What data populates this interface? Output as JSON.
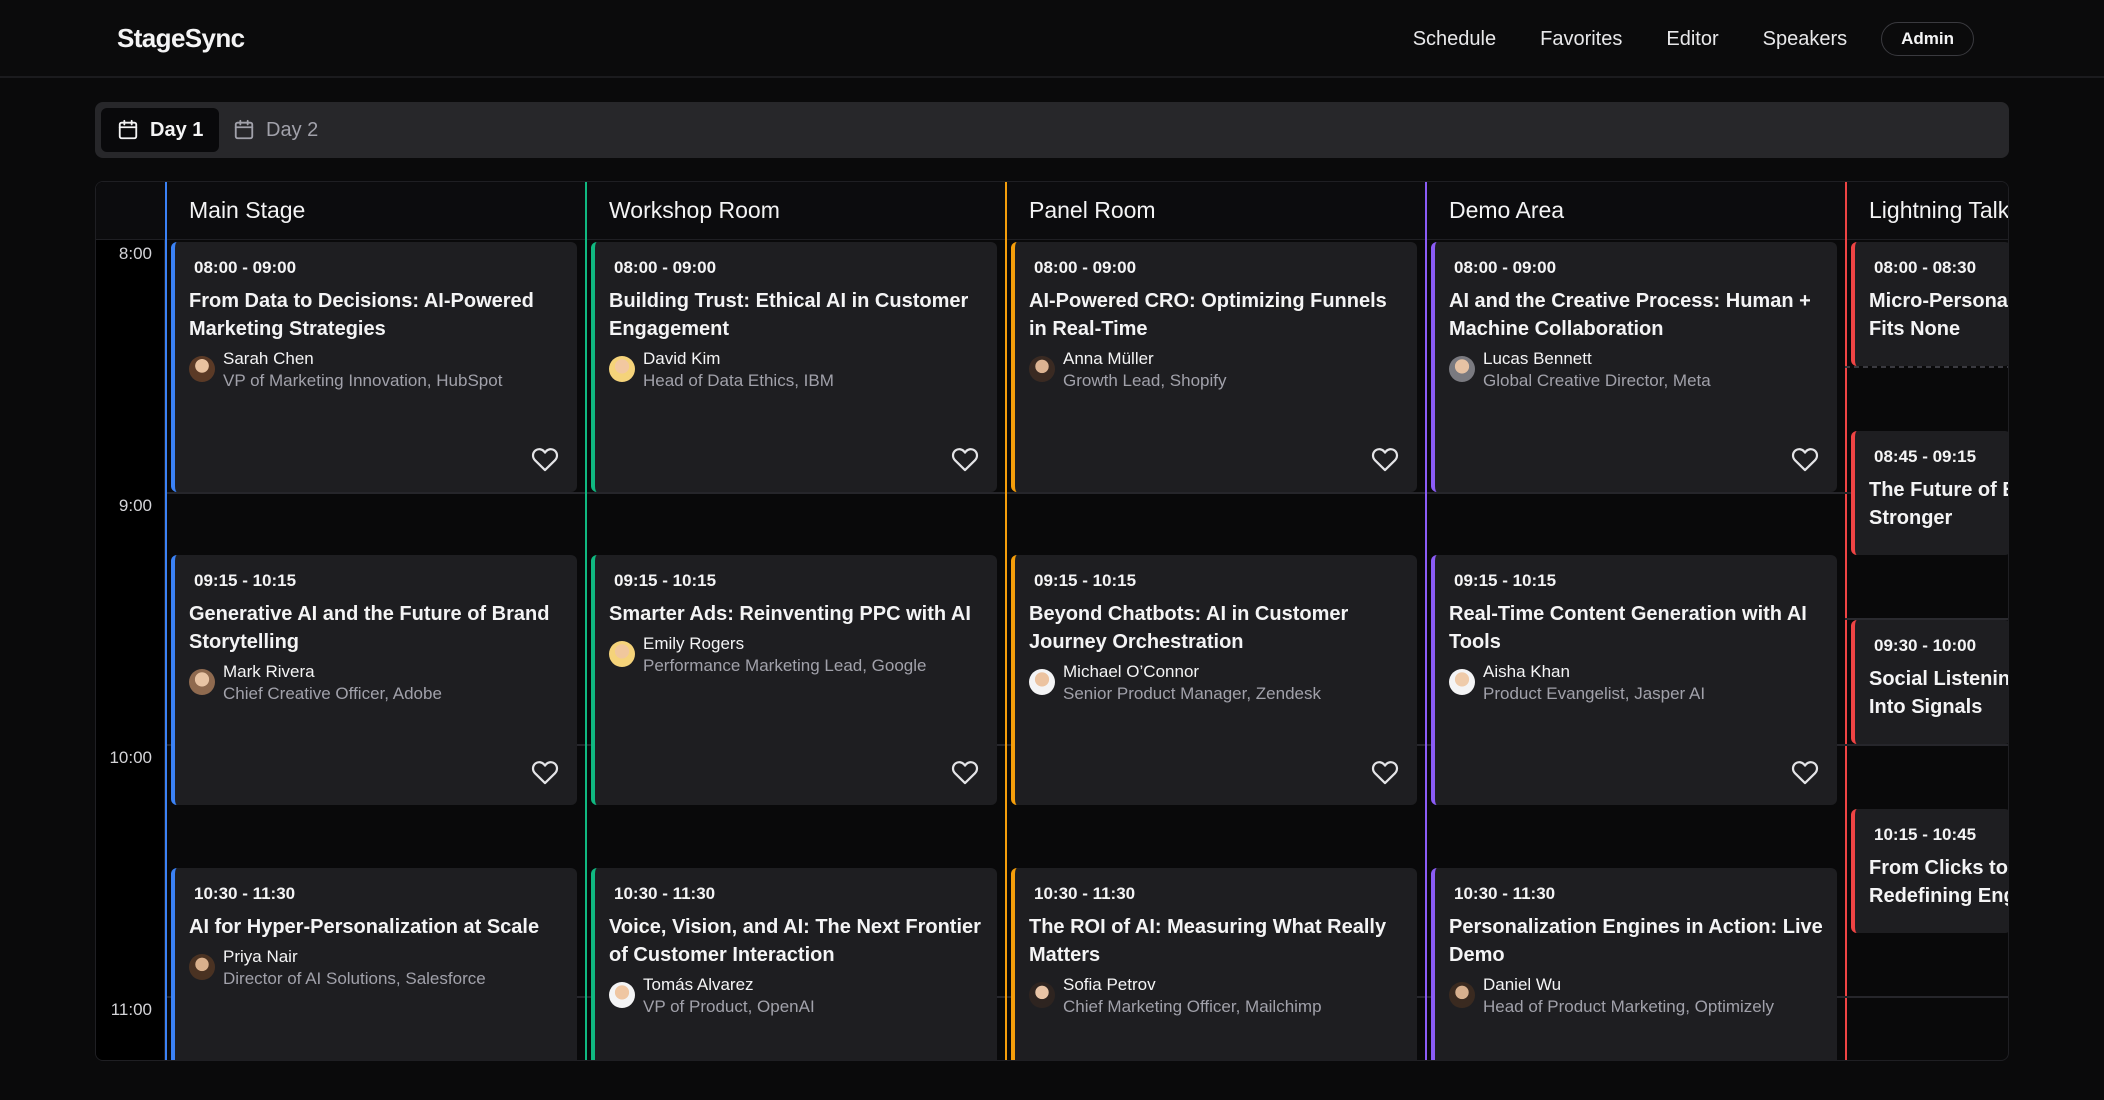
{
  "app": {
    "title": "StageSync"
  },
  "nav": {
    "schedule": "Schedule",
    "favorites": "Favorites",
    "editor": "Editor",
    "speakers": "Speakers",
    "admin": "Admin"
  },
  "days": [
    {
      "label": "Day 1"
    },
    {
      "label": "Day 2"
    }
  ],
  "times": [
    "8:00",
    "9:00",
    "10:00",
    "11:00"
  ],
  "rooms": [
    {
      "name": "Main Stage",
      "color": "#3b82f6",
      "sessions": [
        {
          "time": "08:00 - 09:00",
          "title": "From Data to Decisions: AI-Powered Marketing Strategies",
          "speaker": "Sarah Chen",
          "role": "VP of Marketing Innovation, HubSpot"
        },
        {
          "time": "09:15 - 10:15",
          "title": "Generative AI and the Future of Brand Storytelling",
          "speaker": "Mark Rivera",
          "role": "Chief Creative Officer, Adobe"
        },
        {
          "time": "10:30 - 11:30",
          "title": "AI for Hyper-Personalization at Scale",
          "speaker": "Priya Nair",
          "role": "Director of AI Solutions, Salesforce"
        }
      ]
    },
    {
      "name": "Workshop Room",
      "color": "#10b981",
      "sessions": [
        {
          "time": "08:00 - 09:00",
          "title": "Building Trust: Ethical AI in Customer Engagement",
          "speaker": "David Kim",
          "role": "Head of Data Ethics, IBM"
        },
        {
          "time": "09:15 - 10:15",
          "title": "Smarter Ads: Reinventing PPC with AI",
          "speaker": "Emily Rogers",
          "role": "Performance Marketing Lead, Google"
        },
        {
          "time": "10:30 - 11:30",
          "title": "Voice, Vision, and AI: The Next Frontier of Customer Interaction",
          "speaker": "Tomás Alvarez",
          "role": "VP of Product, OpenAI"
        }
      ]
    },
    {
      "name": "Panel Room",
      "color": "#f59e0b",
      "sessions": [
        {
          "time": "08:00 - 09:00",
          "title": "AI-Powered CRO: Optimizing Funnels in Real-Time",
          "speaker": "Anna Müller",
          "role": "Growth Lead, Shopify"
        },
        {
          "time": "09:15 - 10:15",
          "title": "Beyond Chatbots: AI in Customer Journey Orchestration",
          "speaker": "Michael O’Connor",
          "role": "Senior Product Manager, Zendesk"
        },
        {
          "time": "10:30 - 11:30",
          "title": "The ROI of AI: Measuring What Really Matters",
          "speaker": "Sofia Petrov",
          "role": "Chief Marketing Officer, Mailchimp"
        }
      ]
    },
    {
      "name": "Demo Area",
      "color": "#8b5cf6",
      "sessions": [
        {
          "time": "08:00 - 09:00",
          "title": "AI and the Creative Process: Human + Machine Collaboration",
          "speaker": "Lucas Bennett",
          "role": "Global Creative Director, Meta"
        },
        {
          "time": "09:15 - 10:15",
          "title": "Real-Time Content Generation with AI Tools",
          "speaker": "Aisha Khan",
          "role": "Product Evangelist, Jasper AI"
        },
        {
          "time": "10:30 - 11:30",
          "title": "Personalization Engines in Action: Live Demo",
          "speaker": "Daniel Wu",
          "role": "Head of Product Marketing, Optimizely"
        }
      ]
    }
  ],
  "lightning": {
    "name": "Lightning Talks",
    "color": "#ef4444",
    "sessions": [
      {
        "time": "08:00 - 08:30",
        "title": "Micro-Personas: Why One Size Fits None"
      },
      {
        "time": "08:45 - 09:15",
        "title": "The Future of Email: Smarter, Stronger"
      },
      {
        "time": "09:30 - 10:00",
        "title": "Social Listening: Turning Noise Into Signals"
      },
      {
        "time": "10:15 - 10:45",
        "title": "From Clicks to Conversations: Redefining Engagement"
      }
    ]
  },
  "icons": {
    "calendar": "calendar-icon",
    "heart": "heart-icon"
  }
}
